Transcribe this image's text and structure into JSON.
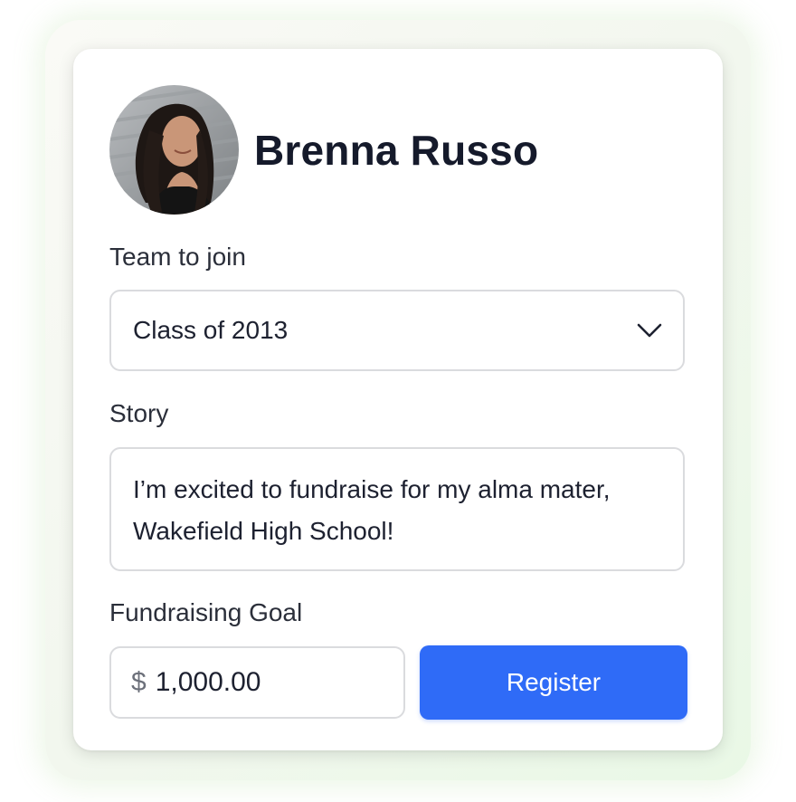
{
  "profile": {
    "name": "Brenna Russo",
    "avatar_icon": "profile-photo"
  },
  "team": {
    "label": "Team to join",
    "selected": "Class of 2013",
    "chevron_icon": "chevron-down-icon"
  },
  "story": {
    "label": "Story",
    "text": "I’m excited to fundraise for my alma mater, Wakefield High School!"
  },
  "goal": {
    "label": "Fundraising Goal",
    "currency_symbol": "$",
    "amount": "1,000.00"
  },
  "actions": {
    "register_label": "Register"
  },
  "colors": {
    "accent": "#2f6bf7",
    "text": "#151a2b",
    "border": "#dadbde"
  }
}
